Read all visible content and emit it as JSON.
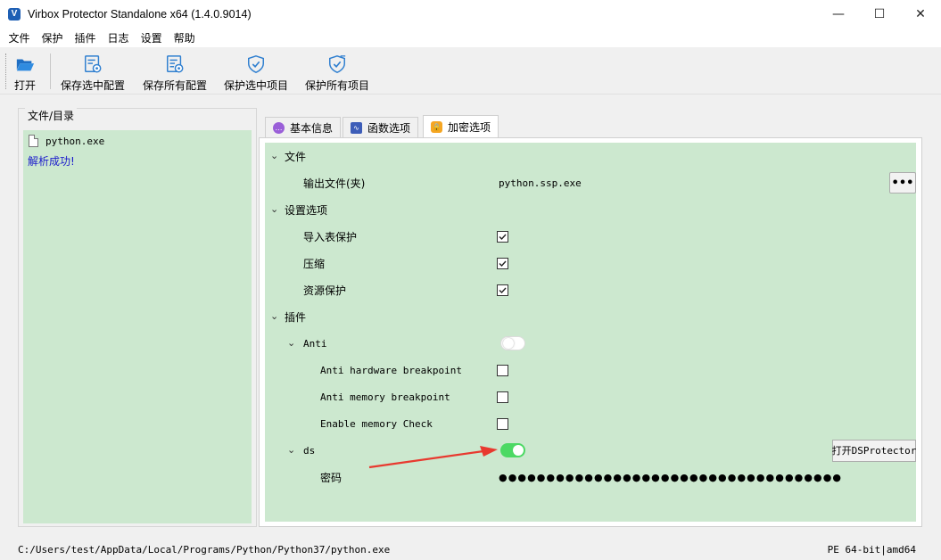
{
  "window": {
    "title": "Virbox Protector Standalone x64  (1.4.0.9014)",
    "icon_letter": "V",
    "controls": {
      "minimize": "—",
      "maximize": "☐",
      "close": "✕"
    }
  },
  "menu": [
    "文件",
    "保护",
    "插件",
    "日志",
    "设置",
    "帮助"
  ],
  "toolbar": {
    "open": "打开",
    "save_selected": "保存选中配置",
    "save_all": "保存所有配置",
    "protect_selected": "保护选中项目",
    "protect_all": "保护所有项目"
  },
  "left_panel": {
    "legend": "文件/目录",
    "file": "python.exe",
    "status": "解析成功!"
  },
  "tabs": [
    "基本信息",
    "函数选项",
    "加密选项"
  ],
  "active_tab": "加密选项",
  "sections": {
    "file": {
      "label": "文件",
      "output_label": "输出文件(夹)",
      "output_value": "python.ssp.exe",
      "browse": "•••"
    },
    "settings": {
      "label": "设置选项",
      "import_protect": "导入表保护",
      "compress": "压缩",
      "resource_protect": "资源保护"
    },
    "plugins": {
      "label": "插件",
      "anti": {
        "label": "Anti",
        "hw_bp": "Anti hardware breakpoint",
        "mem_bp": "Anti memory breakpoint",
        "mem_check": "Enable memory Check"
      },
      "ds": {
        "label": "ds",
        "open_button": "打开DSProtector",
        "password_label": "密码",
        "password_mask": "●●●●●●●●●●●●●●●●●●●●●●●●●●●●●●●●●●●●●●●●"
      }
    }
  },
  "status": {
    "path": "C:/Users/test/AppData/Local/Programs/Python/Python37/python.exe",
    "arch": "PE 64-bit|amd64"
  },
  "colors": {
    "panel_bg": "#cce8cf",
    "toggle_on": "#4cd964",
    "arrow": "#e8392f",
    "status_link": "#1b1bcc"
  }
}
